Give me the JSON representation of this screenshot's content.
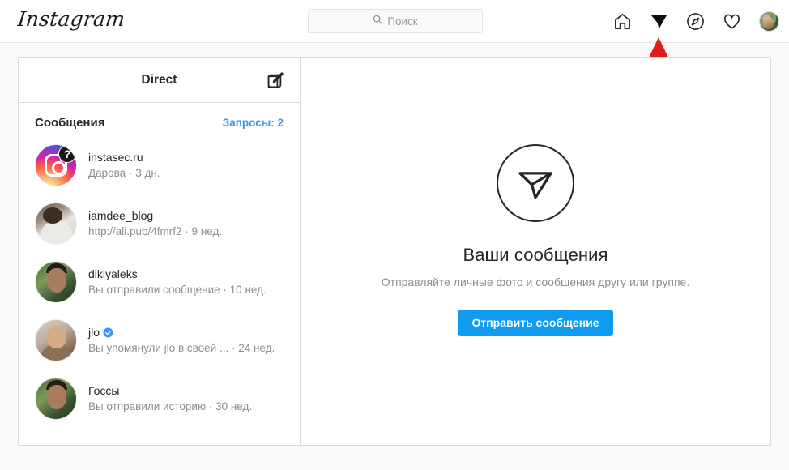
{
  "navbar": {
    "logo": "Instagram",
    "search": {
      "placeholder": "Поиск",
      "value": "",
      "icon": "search-icon"
    },
    "icons": [
      {
        "name": "home-icon",
        "label": "Главная",
        "active": false
      },
      {
        "name": "direct-paper-plane-icon",
        "label": "Direct",
        "active": true
      },
      {
        "name": "compass-explore-icon",
        "label": "Интересное",
        "active": false
      },
      {
        "name": "heart-activity-icon",
        "label": "Уведомления",
        "active": false
      },
      {
        "name": "profile-avatar",
        "label": "Профиль",
        "active": false
      }
    ]
  },
  "annotation": {
    "type": "arrow",
    "direction": "up",
    "color": "#e21b1b",
    "points_at": "direct-paper-plane-icon"
  },
  "sidebar": {
    "title": "Direct",
    "compose_icon": "compose-pencil-icon",
    "section_title": "Сообщения",
    "requests_label": "Запросы: 2",
    "requests_color": "#3897f0",
    "threads": [
      {
        "name": "instasec.ru",
        "snippet": "Дарова · 3 дн.",
        "avatar": "instagram-logo-avatar",
        "badge": "?",
        "verified": false
      },
      {
        "name": "iamdee_blog",
        "snippet": "http://ali.pub/4fmrf2 · 9 нед.",
        "avatar": "person-avatar",
        "badge": "",
        "verified": false
      },
      {
        "name": "dikiyaleks",
        "snippet": "Вы отправили сообщение · 10 нед.",
        "avatar": "person-avatar",
        "badge": "",
        "verified": false
      },
      {
        "name": "jlo",
        "snippet": "Вы упомянули jlo в своей ...  · 24 нед.",
        "avatar": "person-avatar",
        "badge": "",
        "verified": true
      },
      {
        "name": "Госсы",
        "snippet": "Вы отправили историю · 30 нед.",
        "avatar": "person-avatar",
        "badge": "",
        "verified": false
      }
    ]
  },
  "empty_state": {
    "icon": "paper-plane-outline-icon",
    "title": "Ваши сообщения",
    "subtitle": "Отправляйте личные фото и сообщения другу или группе.",
    "button_label": "Отправить сообщение",
    "button_color": "#0f9bf0"
  }
}
